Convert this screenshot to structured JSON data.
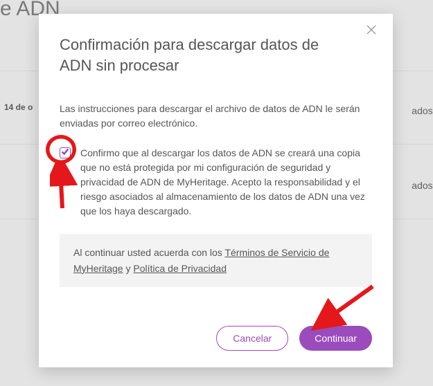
{
  "colors": {
    "accent": "#9a4bbc"
  },
  "bg": {
    "title_fragment": "s de ADN",
    "date_fragment": "14 de o",
    "result_fragment": "ados esta"
  },
  "modal": {
    "title": "Confirmación para descargar datos de ADN sin procesar",
    "intro": "Las instrucciones para descargar el archivo de datos de ADN le serán enviadas por correo electrónico.",
    "consent": {
      "checked": true,
      "text": "Confirmo que al descargar los datos de ADN se creará una copia que no está protegida por mi configuración de seguridad y privacidad de ADN de MyHeritage. Acepto la responsabilidad y el riesgo asociados al almacenamiento de los datos de ADN una vez que los haya descargado."
    },
    "legal": {
      "prefix": "Al continuar usted acuerda con los ",
      "terms": "Términos de Servicio de MyHeritage",
      "joiner": " y ",
      "privacy": "Política de Privacidad"
    },
    "buttons": {
      "cancel": "Cancelar",
      "continue": "Continuar"
    }
  }
}
